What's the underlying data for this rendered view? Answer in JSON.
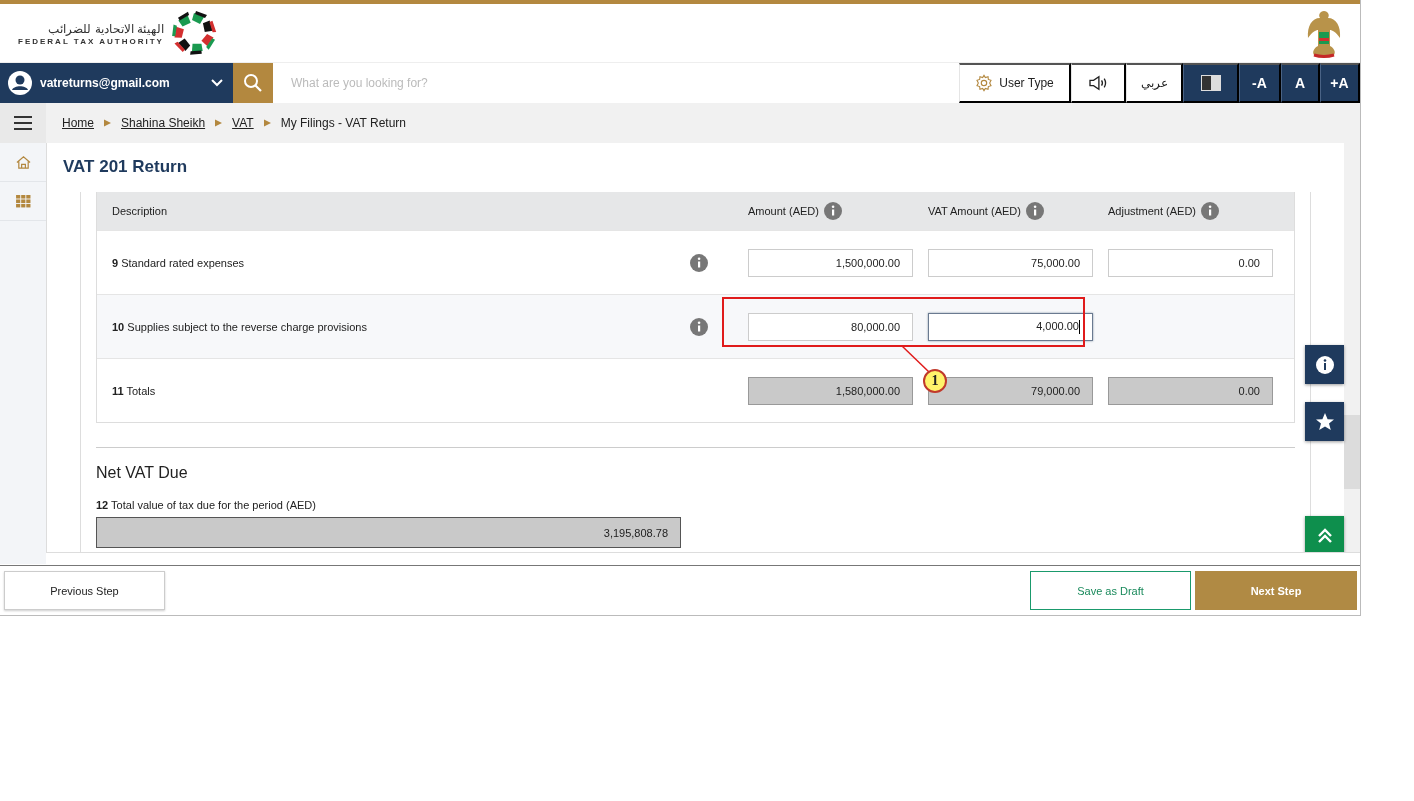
{
  "header": {
    "logo_arabic": "الهيئة الاتحادية للضرائب",
    "logo_english": "FEDERAL TAX AUTHORITY"
  },
  "navbar": {
    "user_email": "vatreturns@gmail.com",
    "search": {
      "placeholder": "What are you looking for?"
    },
    "user_type": "User Type",
    "language": "عربي",
    "font_buttons": [
      "-A",
      "A",
      "+A"
    ]
  },
  "breadcrumb": [
    {
      "label": "Home",
      "link": true
    },
    {
      "label": "Shahina Sheikh",
      "link": true
    },
    {
      "label": "VAT",
      "link": true
    },
    {
      "label": "My Filings - VAT Return",
      "link": false
    }
  ],
  "page_title": "VAT 201 Return",
  "table": {
    "columns": [
      "Description",
      "Amount (AED)",
      "VAT Amount (AED)",
      "Adjustment (AED)"
    ],
    "rows": [
      {
        "kind": "input",
        "number": "9",
        "description": "Standard rated expenses",
        "amount": {
          "value": "1,500,000.00",
          "focused": false
        },
        "vat_amount": {
          "value": "75,000.00",
          "focused": false
        },
        "adjustment": {
          "value": "0.00",
          "focused": false
        }
      },
      {
        "kind": "input",
        "number": "10",
        "description": "Supplies subject to the reverse charge provisions",
        "amount": {
          "value": "80,000.00",
          "focused": false
        },
        "vat_amount": {
          "value": "4,000.00",
          "focused": true
        }
      },
      {
        "kind": "total",
        "number": "11",
        "description": "Totals",
        "amount": {
          "value": "1,580,000.00",
          "focused": false
        },
        "vat_amount": {
          "value": "79,000.00",
          "focused": false
        },
        "adjustment": {
          "value": "0.00",
          "focused": false
        }
      }
    ]
  },
  "annotation": {
    "marker": "1"
  },
  "net_vat": {
    "heading": "Net VAT Due",
    "number": "12",
    "label": "Total value of tax due for the period (AED)",
    "value": "3,195,808.78"
  },
  "footer": {
    "previous": "Previous Step",
    "save_draft": "Save as Draft",
    "next": "Next Step"
  }
}
